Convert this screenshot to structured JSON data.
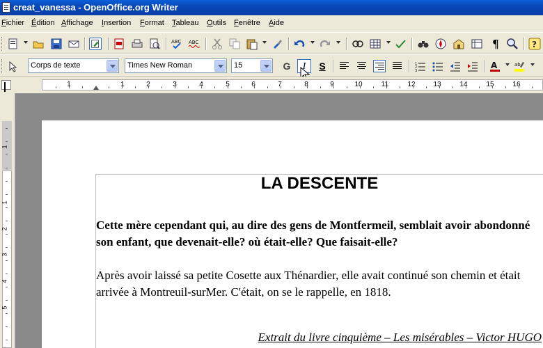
{
  "window": {
    "title": "creat_vanessa - OpenOffice.org Writer"
  },
  "menu": [
    "Fichier",
    "Édition",
    "Affichage",
    "Insertion",
    "Format",
    "Tableau",
    "Outils",
    "Fenêtre",
    "Aide"
  ],
  "formatting": {
    "paragraph_style": "Corps de texte",
    "font_name": "Times New Roman",
    "font_size": "15",
    "bold_label": "G",
    "italic_label": "I",
    "underline_label": "S"
  },
  "ruler": {
    "numbers": [
      "1",
      "1",
      "2",
      "3",
      "4",
      "5",
      "6",
      "7",
      "8",
      "9",
      "10",
      "11",
      "12",
      "13",
      "14",
      "15",
      "16"
    ],
    "vertical_numbers": [
      "1",
      "1",
      "2",
      "3",
      "4",
      "5"
    ]
  },
  "document": {
    "title": "LA DESCENTE",
    "paragraph1": "Cette mère cependant qui, au dire des gens de Montfermeil, semblait avoir abondonné son enfant, que devenait-elle? où était-elle? Que faisait-elle?",
    "paragraph2": "Après avoir laissé sa petite Cosette aux Thénardier, elle avait continué son chemin et était arrivée à Montreuil-surMer. C'était, on se le rappelle, en 1818.",
    "citation": "Extrait du livre cinquième – Les misérables – Victor HUGO"
  },
  "colors": {
    "titlebar": "#0a5fd8",
    "font_color": "#c00000",
    "highlight": "#ffff00"
  }
}
